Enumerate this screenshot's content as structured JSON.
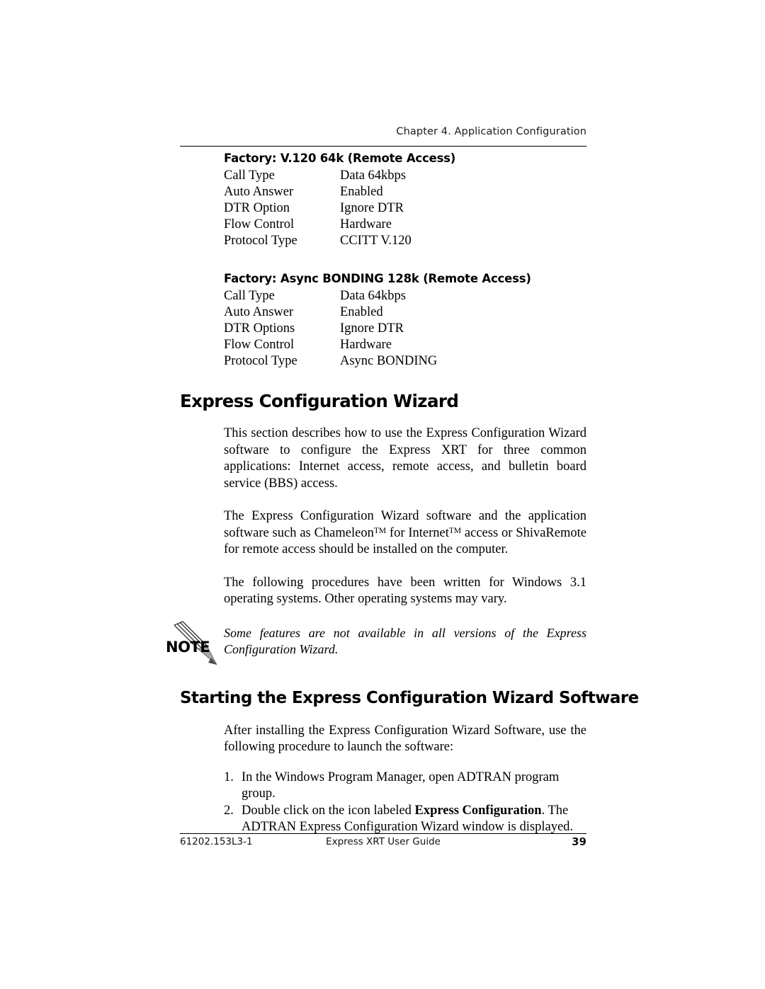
{
  "header": {
    "running_head": "Chapter 4. Application Configuration"
  },
  "spec_blocks": [
    {
      "title": "Factory: V.120 64k (Remote Access)",
      "rows": [
        {
          "key": "Call Type",
          "value": "Data 64kbps"
        },
        {
          "key": "Auto Answer",
          "value": "Enabled"
        },
        {
          "key": "DTR Option",
          "value": "Ignore DTR"
        },
        {
          "key": "Flow Control",
          "value": "Hardware"
        },
        {
          "key": "Protocol Type",
          "value": "CCITT V.120"
        }
      ]
    },
    {
      "title": "Factory: Async BONDING 128k (Remote Access)",
      "rows": [
        {
          "key": "Call Type",
          "value": "Data 64kbps"
        },
        {
          "key": "Auto Answer",
          "value": "Enabled"
        },
        {
          "key": "DTR Options",
          "value": "Ignore DTR"
        },
        {
          "key": "Flow Control",
          "value": "Hardware"
        },
        {
          "key": "Protocol Type",
          "value": "Async BONDING"
        }
      ]
    }
  ],
  "sections": {
    "wizard": {
      "heading": "Express Configuration Wizard",
      "paragraph_1": "This section describes how to use the Express Configuration Wizard software to configure the Express XRT for three common applications:  Internet access, remote access, and bulletin board service (BBS) access.",
      "paragraph_2_part_1": "The Express Configuration Wizard software and the application software such as Chameleon",
      "paragraph_2_tm_1": "TM",
      "paragraph_2_part_2": " for Internet",
      "paragraph_2_tm_2": "TM",
      "paragraph_2_part_3": " access or ShivaRemote for remote access should be installed on the computer.",
      "paragraph_3": "The following procedures have been written for Windows 3.1 operating systems.  Other operating systems may vary."
    },
    "note": {
      "label": "NOTE",
      "text": "Some features are not available in all versions of the Express Configuration Wizard."
    },
    "starting": {
      "heading": "Starting the Express Configuration Wizard Software",
      "intro": "After installing the Express Configuration Wizard Software, use the following procedure to launch the software:",
      "steps": [
        {
          "text_before": "In the Windows Program Manager, open ADTRAN program group.",
          "bold": "",
          "text_after": ""
        },
        {
          "text_before": "Double click on the icon labeled ",
          "bold": "Express Configuration",
          "text_after": ".  The ADTRAN Express Configuration Wizard window is displayed."
        }
      ]
    }
  },
  "footer": {
    "doc_id": "61202.153L3-1",
    "guide_title": "Express XRT User Guide",
    "page_number": "39"
  }
}
